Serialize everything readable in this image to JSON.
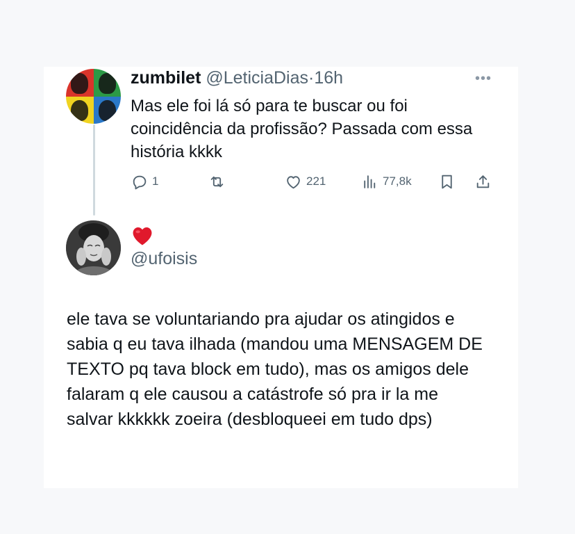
{
  "tweet": {
    "author": "zumbilet",
    "handle": "@LeticiaDias",
    "separator": "·",
    "time": "16h",
    "text": "Mas ele foi lá só para te buscar ou foi coincidência da profissão? Passada com essa história kkkk",
    "actions": {
      "replies": "1",
      "retweets": "",
      "likes": "221",
      "views": "77,8k"
    },
    "icons": {
      "more": "more-dots-icon",
      "reply": "reply-bubble-icon",
      "retweet": "retweet-icon",
      "like": "heart-outline-icon",
      "views": "views-bar-chart-icon",
      "bookmark": "bookmark-icon",
      "share": "share-upload-icon"
    }
  },
  "reply": {
    "emoji": "red-heart-emoji",
    "handle": "@ufoisis",
    "text": "ele tava se voluntariando pra ajudar os atingidos e sabia q eu tava ilhada (mandou uma MENSAGEM DE TEXTO pq tava block em tudo), mas os amigos dele falaram q ele causou a catástrofe só pra ir la me salvar kkkkkk zoeira (desbloqueei em tudo dps)"
  },
  "colors": {
    "text_primary": "#0f1419",
    "text_secondary": "#536471",
    "thread_line": "#cfd9de",
    "heart": "#e0192c",
    "page_background": "#f7f8fa"
  }
}
